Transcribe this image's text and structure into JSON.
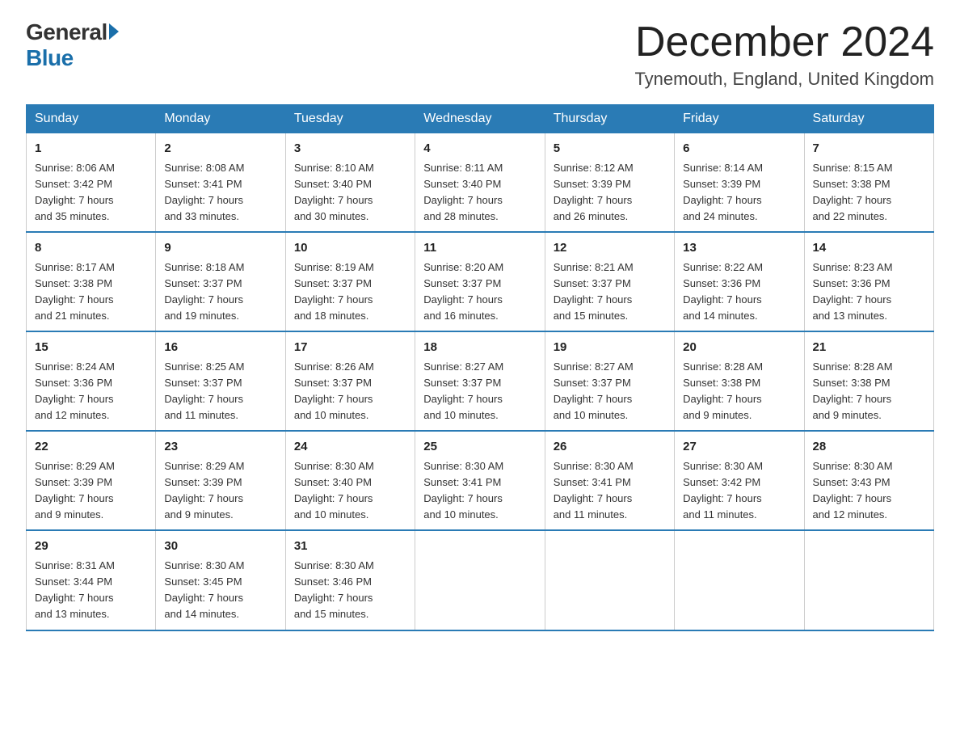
{
  "logo": {
    "general": "General",
    "blue": "Blue"
  },
  "header": {
    "month_year": "December 2024",
    "location": "Tynemouth, England, United Kingdom"
  },
  "days_of_week": [
    "Sunday",
    "Monday",
    "Tuesday",
    "Wednesday",
    "Thursday",
    "Friday",
    "Saturday"
  ],
  "weeks": [
    [
      {
        "day": "1",
        "info": "Sunrise: 8:06 AM\nSunset: 3:42 PM\nDaylight: 7 hours\nand 35 minutes."
      },
      {
        "day": "2",
        "info": "Sunrise: 8:08 AM\nSunset: 3:41 PM\nDaylight: 7 hours\nand 33 minutes."
      },
      {
        "day": "3",
        "info": "Sunrise: 8:10 AM\nSunset: 3:40 PM\nDaylight: 7 hours\nand 30 minutes."
      },
      {
        "day": "4",
        "info": "Sunrise: 8:11 AM\nSunset: 3:40 PM\nDaylight: 7 hours\nand 28 minutes."
      },
      {
        "day": "5",
        "info": "Sunrise: 8:12 AM\nSunset: 3:39 PM\nDaylight: 7 hours\nand 26 minutes."
      },
      {
        "day": "6",
        "info": "Sunrise: 8:14 AM\nSunset: 3:39 PM\nDaylight: 7 hours\nand 24 minutes."
      },
      {
        "day": "7",
        "info": "Sunrise: 8:15 AM\nSunset: 3:38 PM\nDaylight: 7 hours\nand 22 minutes."
      }
    ],
    [
      {
        "day": "8",
        "info": "Sunrise: 8:17 AM\nSunset: 3:38 PM\nDaylight: 7 hours\nand 21 minutes."
      },
      {
        "day": "9",
        "info": "Sunrise: 8:18 AM\nSunset: 3:37 PM\nDaylight: 7 hours\nand 19 minutes."
      },
      {
        "day": "10",
        "info": "Sunrise: 8:19 AM\nSunset: 3:37 PM\nDaylight: 7 hours\nand 18 minutes."
      },
      {
        "day": "11",
        "info": "Sunrise: 8:20 AM\nSunset: 3:37 PM\nDaylight: 7 hours\nand 16 minutes."
      },
      {
        "day": "12",
        "info": "Sunrise: 8:21 AM\nSunset: 3:37 PM\nDaylight: 7 hours\nand 15 minutes."
      },
      {
        "day": "13",
        "info": "Sunrise: 8:22 AM\nSunset: 3:36 PM\nDaylight: 7 hours\nand 14 minutes."
      },
      {
        "day": "14",
        "info": "Sunrise: 8:23 AM\nSunset: 3:36 PM\nDaylight: 7 hours\nand 13 minutes."
      }
    ],
    [
      {
        "day": "15",
        "info": "Sunrise: 8:24 AM\nSunset: 3:36 PM\nDaylight: 7 hours\nand 12 minutes."
      },
      {
        "day": "16",
        "info": "Sunrise: 8:25 AM\nSunset: 3:37 PM\nDaylight: 7 hours\nand 11 minutes."
      },
      {
        "day": "17",
        "info": "Sunrise: 8:26 AM\nSunset: 3:37 PM\nDaylight: 7 hours\nand 10 minutes."
      },
      {
        "day": "18",
        "info": "Sunrise: 8:27 AM\nSunset: 3:37 PM\nDaylight: 7 hours\nand 10 minutes."
      },
      {
        "day": "19",
        "info": "Sunrise: 8:27 AM\nSunset: 3:37 PM\nDaylight: 7 hours\nand 10 minutes."
      },
      {
        "day": "20",
        "info": "Sunrise: 8:28 AM\nSunset: 3:38 PM\nDaylight: 7 hours\nand 9 minutes."
      },
      {
        "day": "21",
        "info": "Sunrise: 8:28 AM\nSunset: 3:38 PM\nDaylight: 7 hours\nand 9 minutes."
      }
    ],
    [
      {
        "day": "22",
        "info": "Sunrise: 8:29 AM\nSunset: 3:39 PM\nDaylight: 7 hours\nand 9 minutes."
      },
      {
        "day": "23",
        "info": "Sunrise: 8:29 AM\nSunset: 3:39 PM\nDaylight: 7 hours\nand 9 minutes."
      },
      {
        "day": "24",
        "info": "Sunrise: 8:30 AM\nSunset: 3:40 PM\nDaylight: 7 hours\nand 10 minutes."
      },
      {
        "day": "25",
        "info": "Sunrise: 8:30 AM\nSunset: 3:41 PM\nDaylight: 7 hours\nand 10 minutes."
      },
      {
        "day": "26",
        "info": "Sunrise: 8:30 AM\nSunset: 3:41 PM\nDaylight: 7 hours\nand 11 minutes."
      },
      {
        "day": "27",
        "info": "Sunrise: 8:30 AM\nSunset: 3:42 PM\nDaylight: 7 hours\nand 11 minutes."
      },
      {
        "day": "28",
        "info": "Sunrise: 8:30 AM\nSunset: 3:43 PM\nDaylight: 7 hours\nand 12 minutes."
      }
    ],
    [
      {
        "day": "29",
        "info": "Sunrise: 8:31 AM\nSunset: 3:44 PM\nDaylight: 7 hours\nand 13 minutes."
      },
      {
        "day": "30",
        "info": "Sunrise: 8:30 AM\nSunset: 3:45 PM\nDaylight: 7 hours\nand 14 minutes."
      },
      {
        "day": "31",
        "info": "Sunrise: 8:30 AM\nSunset: 3:46 PM\nDaylight: 7 hours\nand 15 minutes."
      },
      null,
      null,
      null,
      null
    ]
  ]
}
